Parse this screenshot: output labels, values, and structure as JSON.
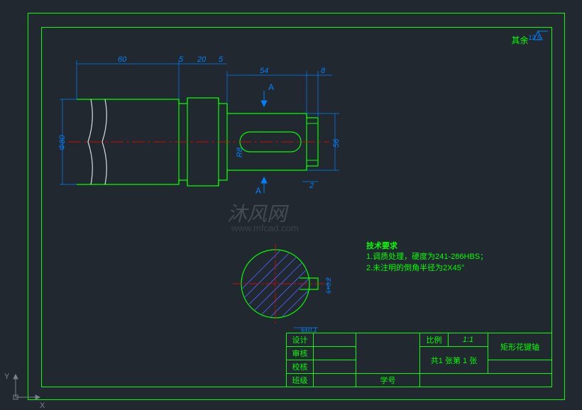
{
  "dimensions": {
    "d60": "60",
    "d5a": "5",
    "d20": "20",
    "d5b": "5",
    "d54": "54",
    "d8": "8",
    "phi80": "Φ80",
    "d56": "56",
    "r8": "R8",
    "d2": "2",
    "d6a": "6±0.1",
    "d6p": "6+0.2"
  },
  "section": {
    "a1": "A",
    "a2": "A"
  },
  "other": "其余",
  "notes": {
    "title": "技术要求",
    "l1": "1.调质处理，硬度为241-286HBS；",
    "l2": "2.未注明的倒角半径为2X45°"
  },
  "titleblock": {
    "r1": "设计",
    "r2": "审核",
    "r3": "校核",
    "r4": "班级",
    "xh": "学号",
    "scale_l": "比例",
    "scale_v": "1:1",
    "sheet": "共1 张第  1 张",
    "name": "矩形花键轴"
  },
  "watermark": {
    "t1": "沐风网",
    "t2": "www.mfcad.com"
  }
}
